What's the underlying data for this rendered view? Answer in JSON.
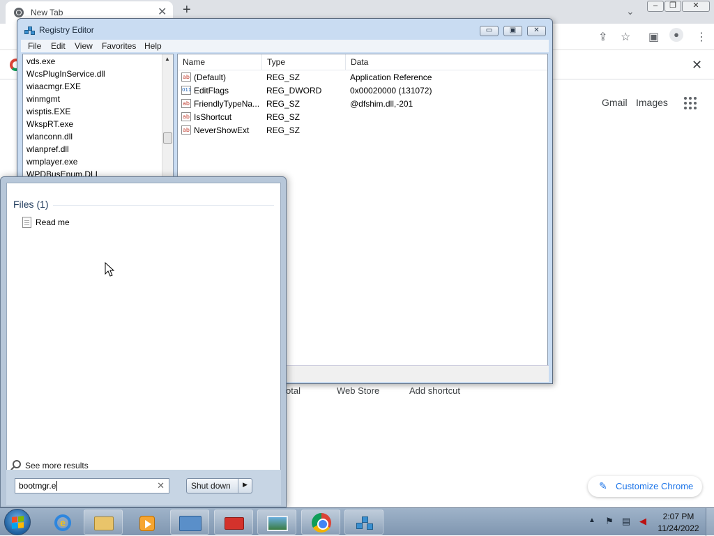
{
  "chrome": {
    "tab_title": "New Tab",
    "tab_close": "✕",
    "new_tab": "+",
    "tablist": "⌄",
    "header_links": [
      "Gmail",
      "Images"
    ],
    "shortcuts": [
      "otal",
      "Web Store",
      "Add shortcut"
    ],
    "customize_label": "Customize Chrome",
    "customize_icon": "✎",
    "infobar_close": "✕"
  },
  "regedit": {
    "title": "Registry Editor",
    "menu": [
      "File",
      "Edit",
      "View",
      "Favorites",
      "Help"
    ],
    "tree_items": [
      "vds.exe",
      "WcsPlugInService.dll",
      "wiaacmgr.EXE",
      "winmgmt",
      "wisptis.EXE",
      "WkspRT.exe",
      "wlanconn.dll",
      "wlanpref.dll",
      "wmplayer.exe",
      "WPDBusEnum.DLL"
    ],
    "columns": [
      "Name",
      "Type",
      "Data"
    ],
    "values": [
      {
        "icon": "ab",
        "name": "(Default)",
        "type": "REG_SZ",
        "data": "Application Reference"
      },
      {
        "icon": "011",
        "name": "EditFlags",
        "type": "REG_DWORD",
        "data": "0x00020000 (131072)"
      },
      {
        "icon": "ab",
        "name": "FriendlyTypeNa...",
        "type": "REG_SZ",
        "data": "@dfshim.dll,-201"
      },
      {
        "icon": "ab",
        "name": "IsShortcut",
        "type": "REG_SZ",
        "data": ""
      },
      {
        "icon": "ab",
        "name": "NeverShowExt",
        "type": "REG_SZ",
        "data": ""
      }
    ]
  },
  "start_menu": {
    "files_heading": "Files (1)",
    "file_items": [
      "Read me"
    ],
    "see_more": "See more results",
    "search_value": "bootmgr.e",
    "search_clear": "✕",
    "shutdown_label": "Shut down",
    "shutdown_arrow": "▶"
  },
  "taskbar": {
    "time": "2:07 PM",
    "date": "11/24/2022",
    "tray_up": "▲"
  }
}
